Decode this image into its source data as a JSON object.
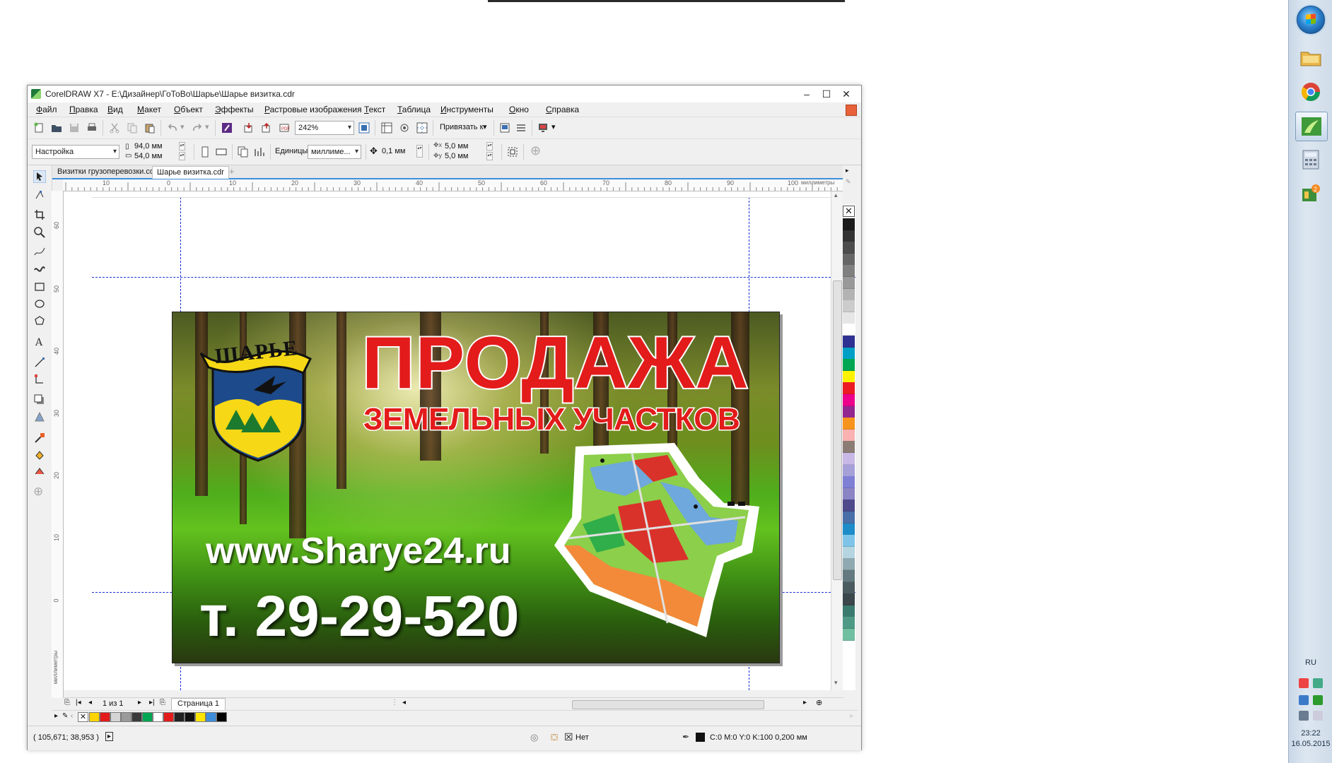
{
  "window": {
    "title": "CorelDRAW X7 - E:\\Дизайнер\\ГоТоВо\\Шарье\\Шарье визитка.cdr",
    "controls": {
      "minimize": "‒",
      "maximize": "☐",
      "close": "✕"
    }
  },
  "menu": [
    "Файл",
    "Правка",
    "Вид",
    "Макет",
    "Объект",
    "Эффекты",
    "Растровые изображения",
    "Текст",
    "Таблица",
    "Инструменты",
    "Окно",
    "Справка"
  ],
  "toolbar1": {
    "zoom": "242%",
    "snap_label": "Привязать к"
  },
  "toolbar2": {
    "preset": "Настройка",
    "width": "94,0 мм",
    "height": "54,0 мм",
    "units_label": "Единицы:",
    "units_value": "миллиме...",
    "nudge": "0,1 мм",
    "dup_x": "5,0 мм",
    "dup_y": "5,0 мм"
  },
  "tabs": [
    "Визитки грузоперевозки.cdr",
    "Шарье визитка.cdr"
  ],
  "hruler": {
    "labels": [
      "10",
      "0",
      "10",
      "20",
      "30",
      "40",
      "50",
      "60",
      "70",
      "80",
      "90",
      "100"
    ],
    "units": "миллиметры"
  },
  "vruler": {
    "labels": [
      "60",
      "50",
      "40",
      "30",
      "20",
      "10",
      "0"
    ],
    "units": "миллиметры"
  },
  "card": {
    "headline": "ПРОДАЖА",
    "subheadline": "ЗЕМЕЛЬНЫХ УЧАСТКОВ",
    "website": "www.Sharye24.ru",
    "phone": "т. 29-29-520",
    "logo_text": "ШАРЬЕ"
  },
  "pagenav": {
    "page_of": "1 из 1",
    "page_tab": "Страница 1"
  },
  "status": {
    "coords": "( 105,671; 38,953 )",
    "fill": "Нет",
    "outline": "C:0 M:0 Y:0 K:100  0,200 мм"
  },
  "taskbar": {
    "lang": "RU",
    "time": "23:22",
    "date": "16.05.2015"
  },
  "colors": {
    "palette": [
      "#1a1a1a",
      "#333333",
      "#4d4d4d",
      "#666666",
      "#808080",
      "#999999",
      "#b3b3b3",
      "#cccccc",
      "#e6e6e6",
      "#ffffff",
      "#2e3192",
      "#00a0c6",
      "#00a651",
      "#fff200",
      "#ed1c24",
      "#ec008c",
      "#92278f",
      "#f7941d",
      "#f9b1b1",
      "#8b7d75",
      "#c7b8e6",
      "#a6a0d8",
      "#7f7fd6",
      "#8a84c4",
      "#4f4a8c",
      "#4a6fa8",
      "#1e8cc8",
      "#7fc4e8",
      "#b5d5e0",
      "#8fa9b0",
      "#647a80",
      "#4c5b60",
      "#3a474b",
      "#3b7a6f",
      "#4f9a86",
      "#6fbfa0"
    ],
    "docpalette": [
      "#ffd400",
      "#e31b1b",
      "#d4d4d4",
      "#9a9a9a",
      "#3a3a3a",
      "#00a651",
      "#ffffff",
      "#e31b1b",
      "#222222",
      "#111111",
      "#ffe600",
      "#3c8edc",
      "#000000"
    ]
  }
}
